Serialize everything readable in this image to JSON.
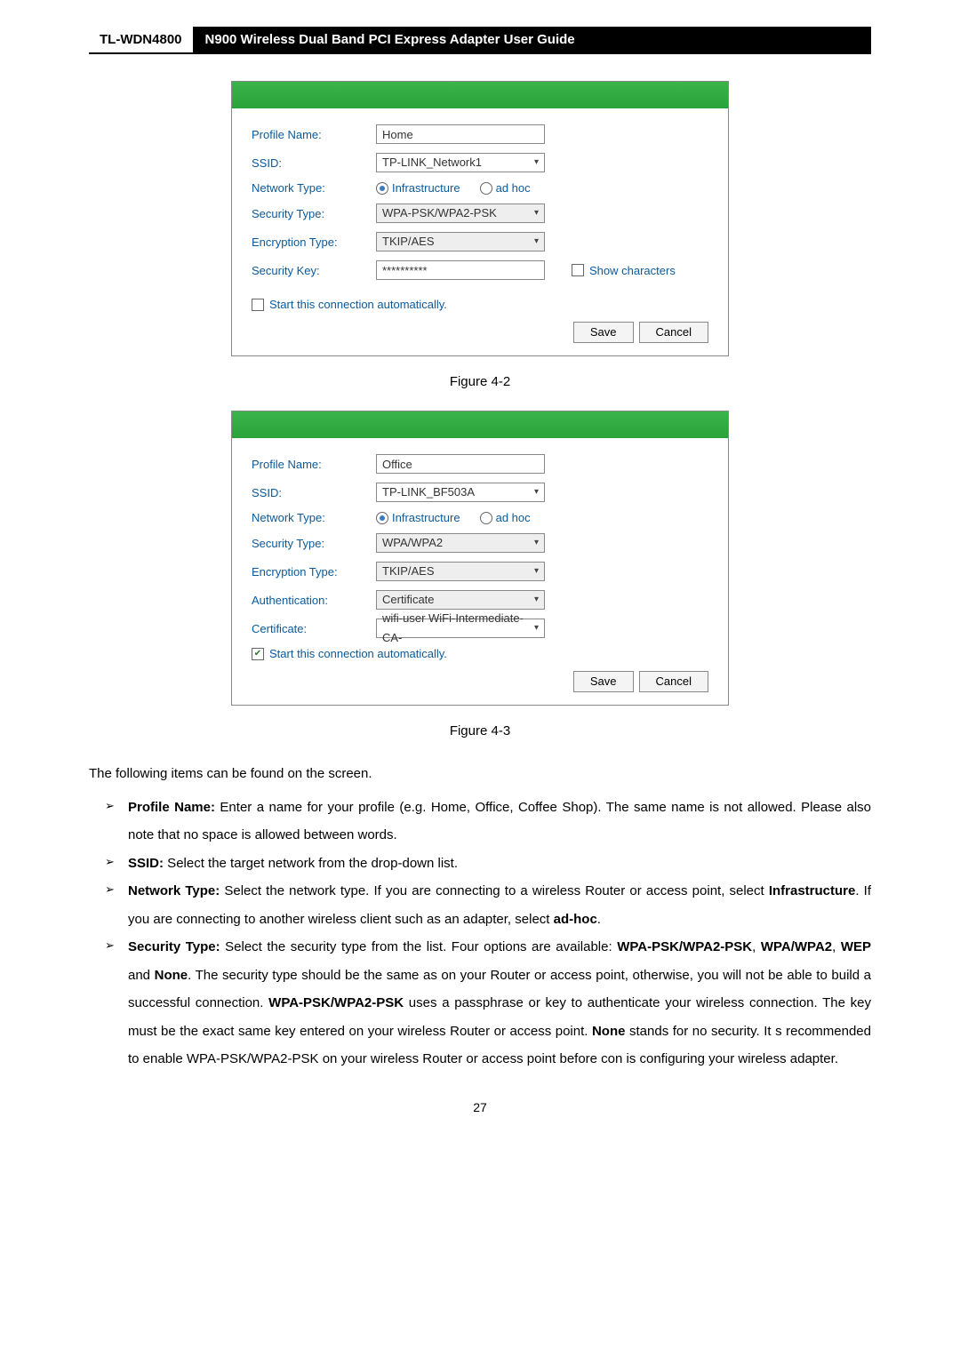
{
  "header": {
    "model": "TL-WDN4800",
    "title": "N900 Wireless Dual Band PCI Express Adapter User Guide"
  },
  "dialog1": {
    "labels": {
      "profile_name": "Profile Name:",
      "ssid": "SSID:",
      "network_type": "Network Type:",
      "security_type": "Security Type:",
      "encryption_type": "Encryption Type:",
      "security_key": "Security Key:"
    },
    "values": {
      "profile_name": "Home",
      "ssid": "TP-LINK_Network1",
      "infrastructure": "Infrastructure",
      "adhoc": "ad hoc",
      "security_type": "WPA-PSK/WPA2-PSK",
      "encryption_type": "TKIP/AES",
      "security_key": "**********"
    },
    "show_characters_label": "Show characters",
    "auto_start_label": "Start this connection automatically.",
    "save_label": "Save",
    "cancel_label": "Cancel"
  },
  "caption1": "Figure 4-2",
  "dialog2": {
    "labels": {
      "profile_name": "Profile Name:",
      "ssid": "SSID:",
      "network_type": "Network Type:",
      "security_type": "Security Type:",
      "encryption_type": "Encryption Type:",
      "authentication": "Authentication:",
      "certificate": "Certificate:"
    },
    "values": {
      "profile_name": "Office",
      "ssid": "TP-LINK_BF503A",
      "infrastructure": "Infrastructure",
      "adhoc": "ad hoc",
      "security_type": "WPA/WPA2",
      "encryption_type": "TKIP/AES",
      "authentication": "Certificate",
      "certificate": "wifi-user WiFi-Intermediate-CA-"
    },
    "auto_start_label": "Start this connection automatically.",
    "save_label": "Save",
    "cancel_label": "Cancel"
  },
  "caption2": "Figure 4-3",
  "intro": "The following items can be found on the screen.",
  "items": {
    "profile_name": {
      "label": "Profile Name:",
      "text": " Enter a name for your profile (e.g. Home, Office, Coffee Shop). The same name is not allowed. Please also note that no space is allowed between words."
    },
    "ssid": {
      "label": "SSID:",
      "text": " Select the target network from the drop-down list."
    },
    "network_type": {
      "label": "Network Type:",
      "text_a": " Select the network type. If you are connecting to a wireless Router or access point, select ",
      "infra": "Infrastructure",
      "text_b": ". If you are connecting to another wireless client such as an adapter, select ",
      "adhoc": "ad-hoc",
      "text_c": "."
    },
    "security_type": {
      "label": "Security Type:",
      "text_a": " Select the security type from the list. Four options are available: ",
      "opt1": "WPA-PSK/WPA2-PSK",
      "sep1": ", ",
      "opt2": "WPA/WPA2",
      "sep2": ", ",
      "opt3": "WEP",
      "and": " and ",
      "opt4": "None",
      "text_b": ". The security type should be the same as on your Router or access point, otherwise, you will not be able to build a successful connection. ",
      "opt5": "WPA-PSK/WPA2-PSK",
      "text_c": " uses a passphrase or key to authenticate your wireless connection. The key must be the exact same key entered on your wireless Router or access point. ",
      "opt6": "None",
      "text_d": " stands for no security. It s recommended to enable WPA-PSK/WPA2-PSK on your wireless Router or access point before con is configuring your wireless adapter."
    }
  },
  "page_number": "27"
}
